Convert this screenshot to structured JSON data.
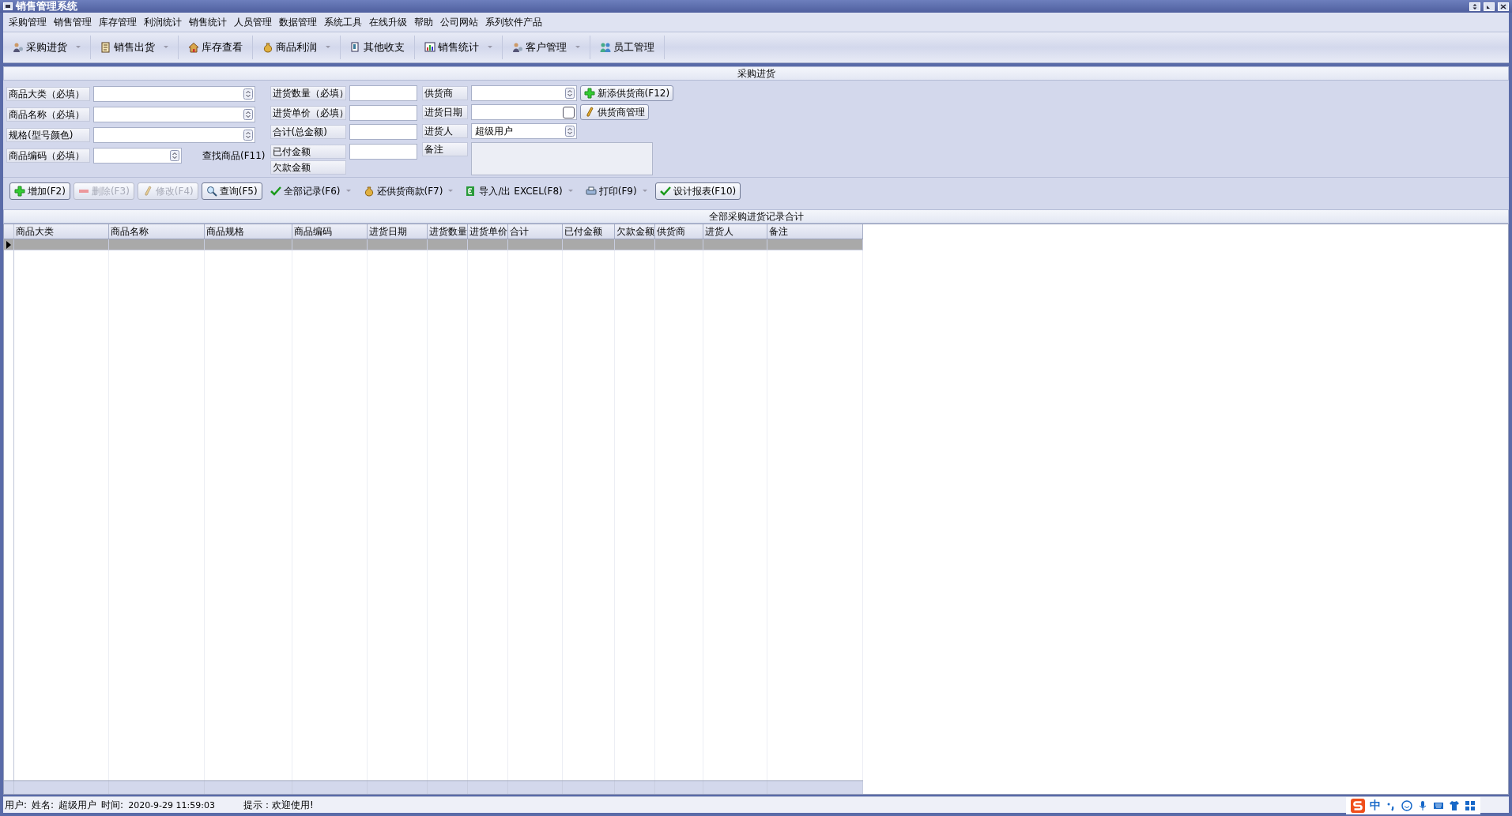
{
  "window": {
    "title": "销售管理系统"
  },
  "menu": [
    "采购管理",
    "销售管理",
    "库存管理",
    "利润统计",
    "销售统计",
    "人员管理",
    "数据管理",
    "系统工具",
    "在线升级",
    "帮助",
    "公司网站",
    "系列软件产品"
  ],
  "toolbar": [
    {
      "label": "采购进货",
      "kind": "people",
      "dropdown": true
    },
    {
      "label": "销售出货",
      "kind": "receipt",
      "dropdown": true
    },
    {
      "label": "库存查看",
      "kind": "house",
      "dropdown": false
    },
    {
      "label": "商品利润",
      "kind": "moneybag",
      "dropdown": true
    },
    {
      "label": "其他收支",
      "kind": "document",
      "dropdown": false
    },
    {
      "label": "销售统计",
      "kind": "chart",
      "dropdown": true
    },
    {
      "label": "客户管理",
      "kind": "people",
      "dropdown": true
    },
    {
      "label": "员工管理",
      "kind": "staff",
      "dropdown": false
    }
  ],
  "panel_title": "采购进货",
  "form": {
    "column_1": [
      {
        "label": "商品大类（必填）",
        "kind": "combo"
      },
      {
        "label": "商品名称（必填）",
        "kind": "combo"
      },
      {
        "label": "规格(型号颜色)",
        "kind": "combo"
      },
      {
        "label": "商品编码（必填）",
        "kind": "short-combo"
      }
    ],
    "search_label": "查找商品(F11)",
    "column_2": [
      {
        "label": "进货数量（必填）",
        "kind": "input"
      },
      {
        "label": "进货单价（必填）",
        "kind": "input"
      },
      {
        "label": "合计(总金额)",
        "kind": "input"
      },
      {
        "label": "已付金额",
        "kind": "input"
      },
      {
        "label": "欠款金额",
        "kind": "none"
      }
    ],
    "column_3": [
      {
        "label": "供货商",
        "kind": "combo"
      },
      {
        "label": "进货日期",
        "kind": "date",
        "checked": false
      },
      {
        "label": "进货人",
        "kind": "combo",
        "value": "超级用户"
      },
      {
        "label": "备注",
        "kind": "memo"
      }
    ],
    "supplier_buttons": [
      {
        "label": "新添供货商(F12)",
        "kind": "plus"
      },
      {
        "label": "供货商管理",
        "kind": "pencil"
      }
    ]
  },
  "actions": [
    {
      "label": "增加(F2)",
      "kind": "plus",
      "disabled": false,
      "dropdown": false,
      "framed": true
    },
    {
      "label": "删除(F3)",
      "kind": "minus",
      "disabled": true,
      "dropdown": false,
      "framed": true
    },
    {
      "label": "修改(F4)",
      "kind": "pencil",
      "disabled": true,
      "dropdown": false,
      "framed": true
    },
    {
      "label": "查询(F5)",
      "kind": "search",
      "disabled": false,
      "dropdown": false,
      "framed": true
    },
    {
      "label": "全部记录(F6)",
      "kind": "check",
      "disabled": false,
      "dropdown": true,
      "framed": false
    },
    {
      "label": "还供货商款(F7)",
      "kind": "moneybag",
      "disabled": false,
      "dropdown": true,
      "framed": false
    },
    {
      "label": "导入/出 EXCEL(F8)",
      "kind": "excel",
      "disabled": false,
      "dropdown": true,
      "framed": false
    },
    {
      "label": "打印(F9)",
      "kind": "printer",
      "disabled": false,
      "dropdown": true,
      "framed": false
    },
    {
      "label": "设计报表(F10)",
      "kind": "check",
      "disabled": false,
      "dropdown": false,
      "framed": true
    }
  ],
  "table": {
    "title": "全部采购进货记录合计",
    "columns": [
      "商品大类",
      "商品名称",
      "商品规格",
      "商品编码",
      "进货日期",
      "进货数量",
      "进货单价",
      "合计",
      "已付金额",
      "欠款金额",
      "供货商",
      "进货人",
      "备注"
    ],
    "rows": [
      {
        "selected": true
      }
    ]
  },
  "status_bar": [
    {
      "label": "用户:"
    },
    {
      "label": "姓名:"
    },
    {
      "label": "超级用户"
    },
    {
      "label": "时间:"
    },
    {
      "label": "2020-9-29 11:59:03"
    },
    {
      "label": "提示：欢迎使用!"
    }
  ],
  "ime_bar": {
    "text": "中"
  }
}
